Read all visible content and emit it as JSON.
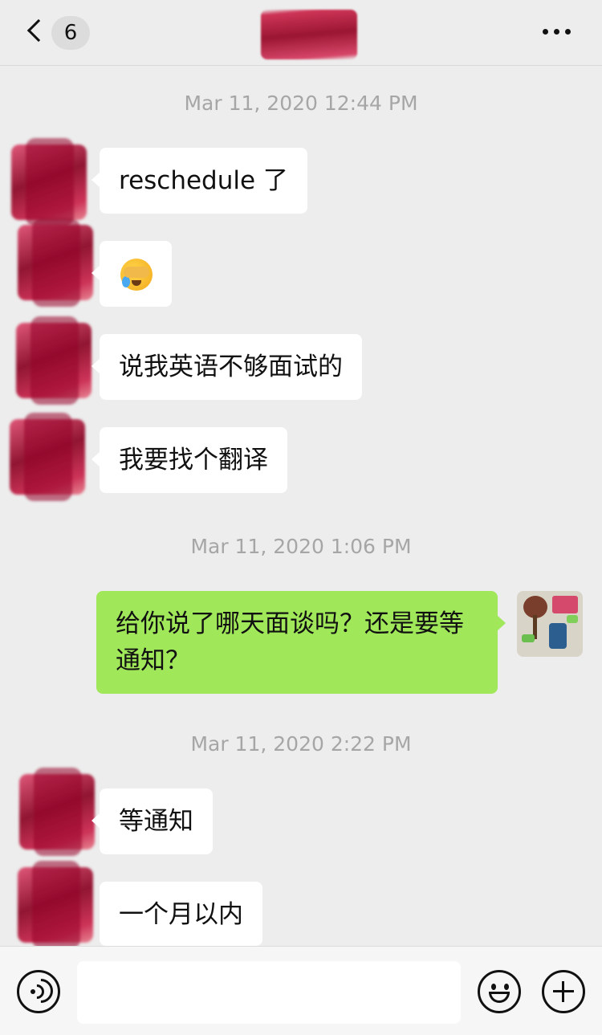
{
  "header": {
    "unread_count": "6",
    "title": "",
    "more_icon": "more-horizontal-icon",
    "back_icon": "chevron-left-icon"
  },
  "messages": {
    "ts1": "Mar 11, 2020 12:44 PM",
    "m1": "reschedule 了",
    "m2_emoji": "face-with-hand-over-mouth-crying-emoji",
    "m3": "说我英语不够面试的",
    "m4": "我要找个翻译",
    "ts2": "Mar 11, 2020 1:06 PM",
    "m5": "给你说了哪天面谈吗？还是要等通知？",
    "ts3": "Mar 11, 2020 2:22 PM",
    "m6": "等通知",
    "m7": "一个月以内"
  },
  "input_bar": {
    "voice_icon": "voice-icon",
    "emoji_icon": "emoji-icon",
    "plus_icon": "plus-icon",
    "input_value": ""
  },
  "colors": {
    "background": "#ededed",
    "bubble_incoming": "#ffffff",
    "bubble_outgoing": "#a0e75a",
    "timestamp": "#a6a6a6"
  }
}
